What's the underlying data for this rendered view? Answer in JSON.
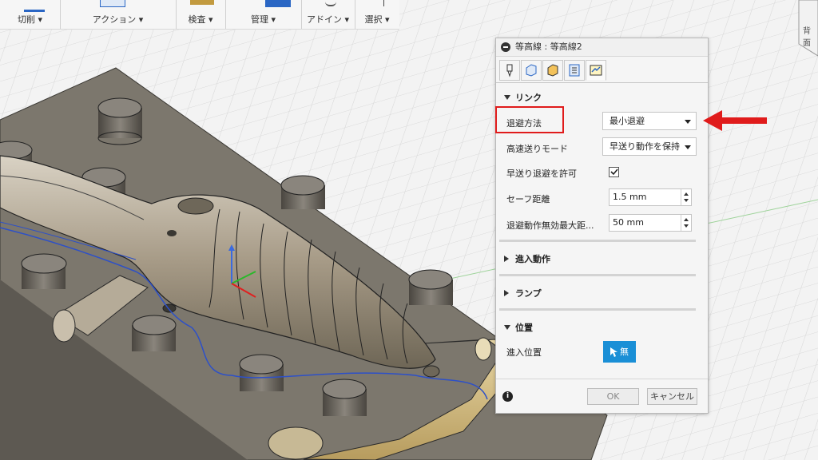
{
  "toolbar": {
    "groups": [
      {
        "label": "切削 ▾"
      },
      {
        "label": "アクション ▾"
      },
      {
        "label": "検査 ▾"
      },
      {
        "label": "管理 ▾"
      },
      {
        "label": "アドイン ▾"
      },
      {
        "label": "選択 ▾"
      }
    ]
  },
  "viewcube": {
    "face_label": "背面"
  },
  "dialog": {
    "title": "等高線 : 等高線2",
    "tabs": [
      "tool-tab",
      "geometry-tab",
      "heights-tab",
      "passes-tab",
      "linking-tab"
    ],
    "sections": {
      "linking": {
        "title": "リンク"
      },
      "lead": {
        "title": "進入動作"
      },
      "ramp": {
        "title": "ランプ"
      },
      "position": {
        "title": "位置"
      }
    },
    "fields": {
      "retract_policy": {
        "label": "退避方法",
        "value": "最小退避"
      },
      "rapid_mode": {
        "label": "高速送りモード",
        "value": "早送り動作を保持"
      },
      "allow_rapid_retract": {
        "label": "早送り退避を許可",
        "checked": true
      },
      "safe_distance": {
        "label": "セーフ距離",
        "value": "1.5 mm"
      },
      "max_stay_down": {
        "label": "退避動作無効最大距...",
        "value": "50 mm"
      },
      "entry_position": {
        "label": "進入位置",
        "button": "無"
      }
    },
    "buttons": {
      "ok": "OK",
      "cancel": "キャンセル"
    }
  },
  "colors": {
    "accent": "#1a8fd6",
    "highlight": "#e01b1b",
    "arrow": "#e01b1b"
  }
}
